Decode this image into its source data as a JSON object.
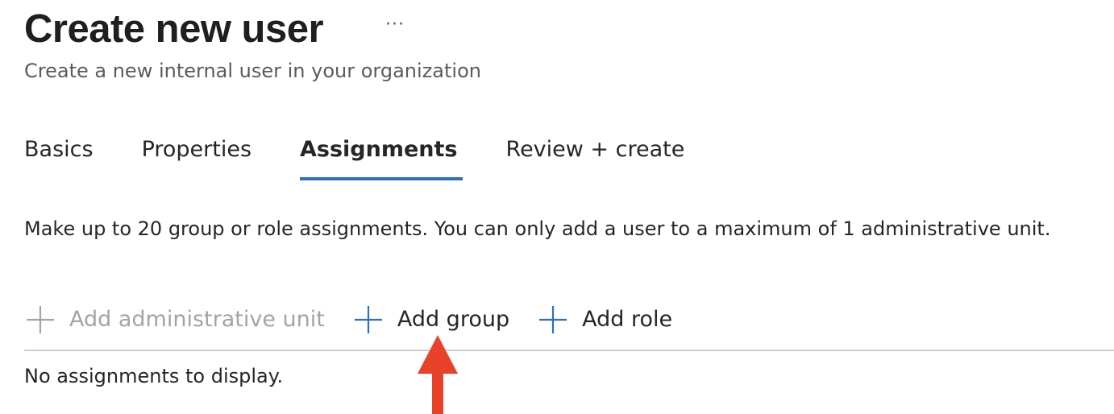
{
  "header": {
    "title": "Create new user",
    "more_label": "···",
    "subtitle": "Create a new internal user in your organization"
  },
  "tabs": [
    {
      "label": "Basics",
      "active": false
    },
    {
      "label": "Properties",
      "active": false
    },
    {
      "label": "Assignments",
      "active": true
    },
    {
      "label": "Review + create",
      "active": false
    }
  ],
  "assignments": {
    "description": "Make up to 20 group or role assignments. You can only add a user to a maximum of 1 administrative unit.",
    "toolbar": {
      "add_admin_unit": {
        "label": "Add administrative unit",
        "icon": "plus-icon",
        "disabled": true
      },
      "add_group": {
        "label": "Add group",
        "icon": "plus-icon",
        "disabled": false
      },
      "add_role": {
        "label": "Add role",
        "icon": "plus-icon",
        "disabled": false
      }
    },
    "empty_message": "No assignments to display."
  },
  "colors": {
    "accent": "#2b6fc7",
    "disabled": "#a4a4a4",
    "annotation_arrow": "#e8432a"
  }
}
